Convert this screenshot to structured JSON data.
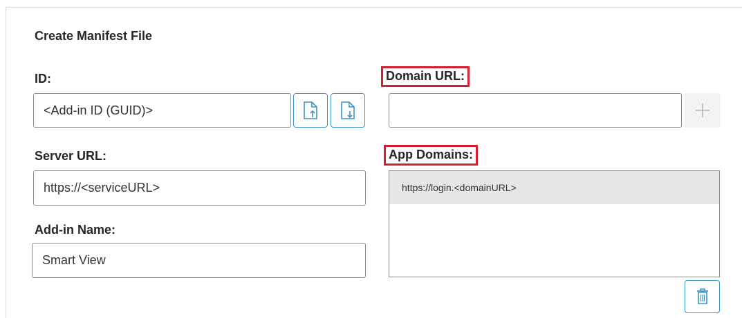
{
  "panel": {
    "title": "Create Manifest File"
  },
  "id_field": {
    "label": "ID:",
    "value": "<Add-in ID (GUID)>",
    "import_icon": "file-import-icon",
    "export_icon": "file-export-icon"
  },
  "domain_url": {
    "label": "Domain URL:",
    "value": "",
    "add_icon": "plus-icon"
  },
  "server_url": {
    "label": "Server URL:",
    "value": "https://<serviceURL>"
  },
  "app_domains": {
    "label": "App Domains:",
    "items": [
      "https://login.<domainURL>"
    ],
    "delete_icon": "trash-icon"
  },
  "addin_name": {
    "label": "Add-in Name:",
    "value": "Smart View"
  },
  "colors": {
    "highlight": "#d32031",
    "accent": "#3a93c8",
    "selected_row": "#e6e6e6"
  }
}
